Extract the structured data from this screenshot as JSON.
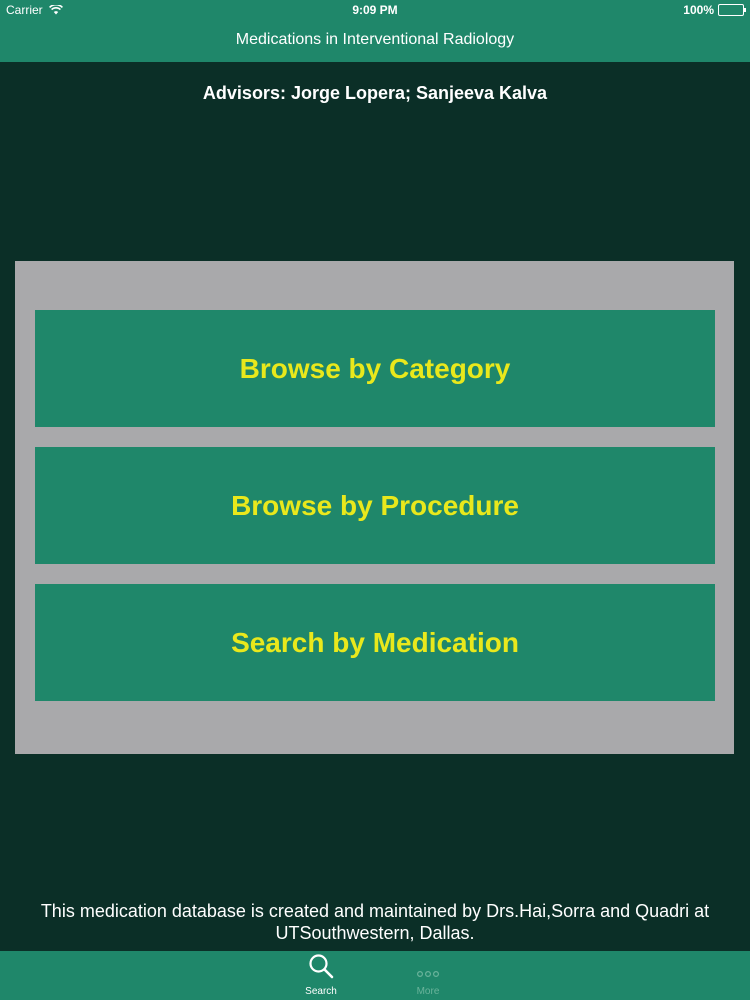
{
  "status_bar": {
    "carrier": "Carrier",
    "time": "9:09 PM",
    "battery": "100%"
  },
  "nav": {
    "title": "Medications in Interventional Radiology"
  },
  "advisors": "Advisors: Jorge Lopera; Sanjeeva Kalva",
  "menu": {
    "browse_category": "Browse by Category",
    "browse_procedure": "Browse by Procedure",
    "search_medication": "Search by Medication"
  },
  "footer": "This medication database is created and maintained by Drs.Hai,Sorra and Quadri at UTSouthwestern, Dallas.",
  "tabs": [
    {
      "label": "Search",
      "icon": "search-icon"
    },
    {
      "label": "More",
      "icon": "more-icon"
    }
  ],
  "colors": {
    "background": "#0b2f27",
    "bar": "#1f876a",
    "panel": "#a9a9ab",
    "button_text": "#e9e81c"
  }
}
